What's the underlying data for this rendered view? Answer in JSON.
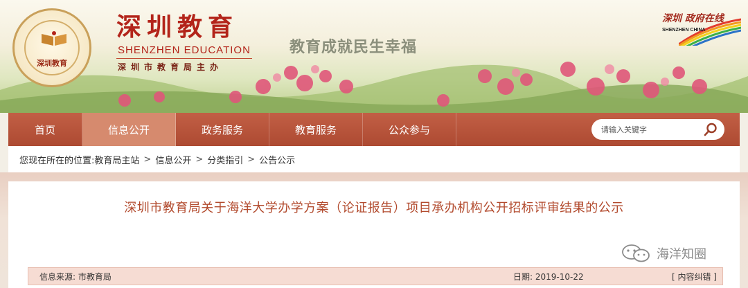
{
  "header": {
    "emblem_text": "深圳教育",
    "title_cn": "深圳教育",
    "title_en": "SHENZHEN EDUCATION",
    "subtitle": "深圳市教育局主办",
    "slogan": "教育成就民生幸福",
    "city_logo_cn": "深圳 政府在线",
    "city_logo_en": "SHENZHEN CHINA"
  },
  "nav": {
    "items": [
      {
        "label": "首页"
      },
      {
        "label": "信息公开"
      },
      {
        "label": "政务服务"
      },
      {
        "label": "教育服务"
      },
      {
        "label": "公众参与"
      }
    ],
    "active_index": 1,
    "search_placeholder": "请输入关键字"
  },
  "breadcrumb": {
    "prefix": "您现在所在的位置:",
    "items": [
      "教育局主站",
      "信息公开",
      "分类指引",
      "公告公示"
    ],
    "separator": ">"
  },
  "article": {
    "title": "深圳市教育局关于海洋大学办学方案（论证报告）项目承办机构公开招标评审结果的公示",
    "source_label": "信息来源:",
    "source_value": "市教育局",
    "date_label": "日期:",
    "date_value": "2019-10-22",
    "report_label": "[ 内容纠错 ]"
  },
  "watermark": {
    "text": "海洋知圈"
  },
  "colors": {
    "nav_bg": "#b8543b",
    "nav_active": "#d68a6e",
    "title_red": "#b3241a",
    "article_title": "#b24a2d",
    "info_bar_bg": "#f6dcd3"
  }
}
